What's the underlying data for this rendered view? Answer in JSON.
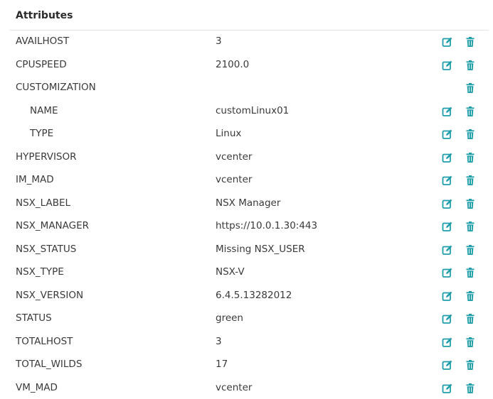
{
  "header": {
    "title": "Attributes"
  },
  "colors": {
    "accent": "#1f9eaa"
  },
  "icons": {
    "edit": "edit-icon",
    "delete": "trash-icon"
  },
  "rows": [
    {
      "key": "AVAILHOST",
      "value": "3",
      "editable": true,
      "child": false
    },
    {
      "key": "CPUSPEED",
      "value": "2100.0",
      "editable": true,
      "child": false
    },
    {
      "key": "CUSTOMIZATION",
      "value": "",
      "editable": false,
      "child": false
    },
    {
      "key": "NAME",
      "value": "customLinux01",
      "editable": true,
      "child": true
    },
    {
      "key": "TYPE",
      "value": "Linux",
      "editable": true,
      "child": true
    },
    {
      "key": "HYPERVISOR",
      "value": "vcenter",
      "editable": true,
      "child": false
    },
    {
      "key": "IM_MAD",
      "value": "vcenter",
      "editable": true,
      "child": false
    },
    {
      "key": "NSX_LABEL",
      "value": "NSX Manager",
      "editable": true,
      "child": false
    },
    {
      "key": "NSX_MANAGER",
      "value": "https://10.0.1.30:443",
      "editable": true,
      "child": false
    },
    {
      "key": "NSX_STATUS",
      "value": "Missing NSX_USER",
      "editable": true,
      "child": false
    },
    {
      "key": "NSX_TYPE",
      "value": "NSX-V",
      "editable": true,
      "child": false
    },
    {
      "key": "NSX_VERSION",
      "value": "6.4.5.13282012",
      "editable": true,
      "child": false
    },
    {
      "key": "STATUS",
      "value": "green",
      "editable": true,
      "child": false
    },
    {
      "key": "TOTALHOST",
      "value": "3",
      "editable": true,
      "child": false
    },
    {
      "key": "TOTAL_WILDS",
      "value": "17",
      "editable": true,
      "child": false
    },
    {
      "key": "VM_MAD",
      "value": "vcenter",
      "editable": true,
      "child": false
    }
  ]
}
